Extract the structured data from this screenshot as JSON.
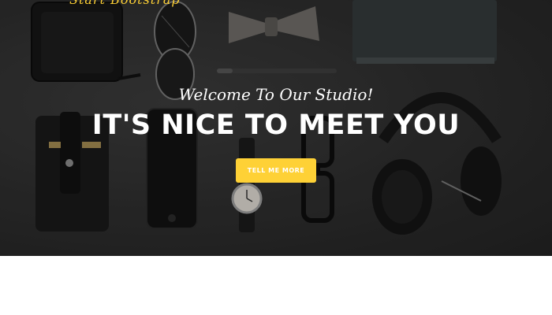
{
  "header": {
    "brand": "Start Bootstrap"
  },
  "hero": {
    "lead_in": "Welcome To Our Studio!",
    "heading": "IT'S NICE TO MEET YOU",
    "button_label": "TELL ME MORE",
    "accent_color": "#fed136"
  }
}
